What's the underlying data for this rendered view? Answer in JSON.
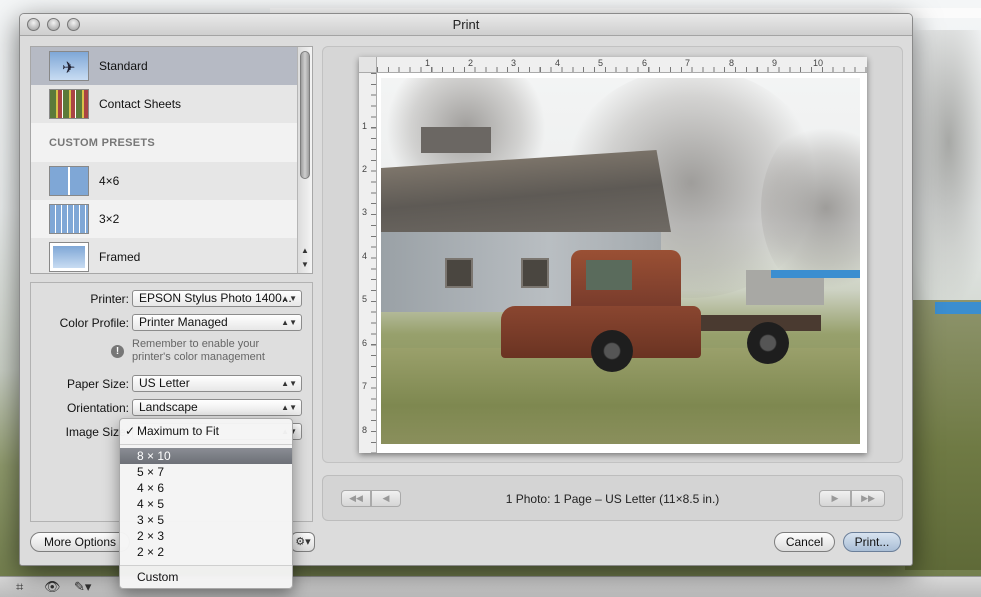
{
  "window": {
    "title": "Print"
  },
  "presets": {
    "items": [
      {
        "label": "Standard",
        "icon": "plane-thumbnail-icon"
      },
      {
        "label": "Contact Sheets",
        "icon": "contact-sheet-thumbnail-icon"
      }
    ],
    "custom_header": "CUSTOM PRESETS",
    "custom_items": [
      {
        "label": "4×6",
        "icon": "two-up-thumbnail-icon"
      },
      {
        "label": "3×2",
        "icon": "six-up-thumbnail-icon"
      },
      {
        "label": "Framed",
        "icon": "framed-thumbnail-icon"
      }
    ]
  },
  "settings": {
    "printer_label": "Printer:",
    "printer_value": "EPSON Stylus Photo 1400...",
    "color_profile_label": "Color Profile:",
    "color_profile_value": "Printer Managed",
    "warning_line1": "Remember to enable your",
    "warning_line2": "printer's color management",
    "paper_size_label": "Paper Size:",
    "paper_size_value": "US Letter",
    "orientation_label": "Orientation:",
    "orientation_value": "Landscape",
    "image_size_label": "Image Size:"
  },
  "image_size_menu": {
    "checked": "Maximum to Fit",
    "highlighted": "8 × 10",
    "options": [
      "5 × 7",
      "4 × 6",
      "4 × 5",
      "3 × 5",
      "2 × 3",
      "2 × 2"
    ],
    "custom": "Custom"
  },
  "ruler": {
    "top": [
      "1",
      "2",
      "3",
      "4",
      "5",
      "6",
      "7",
      "8",
      "9",
      "10"
    ],
    "left": [
      "1",
      "2",
      "3",
      "4",
      "5",
      "6",
      "7",
      "8"
    ]
  },
  "nav": {
    "first": "◀◀",
    "prev": "◀",
    "next": "▶",
    "last": "▶▶",
    "status": "1 Photo: 1 Page – US Letter (11×8.5 in.)"
  },
  "buttons": {
    "more_options": "More Options",
    "gear": "⚙▾",
    "cancel": "Cancel",
    "print": "Print..."
  },
  "toolbar": {
    "crop": "⌗",
    "eye": "👁",
    "brush": "✎▾"
  }
}
